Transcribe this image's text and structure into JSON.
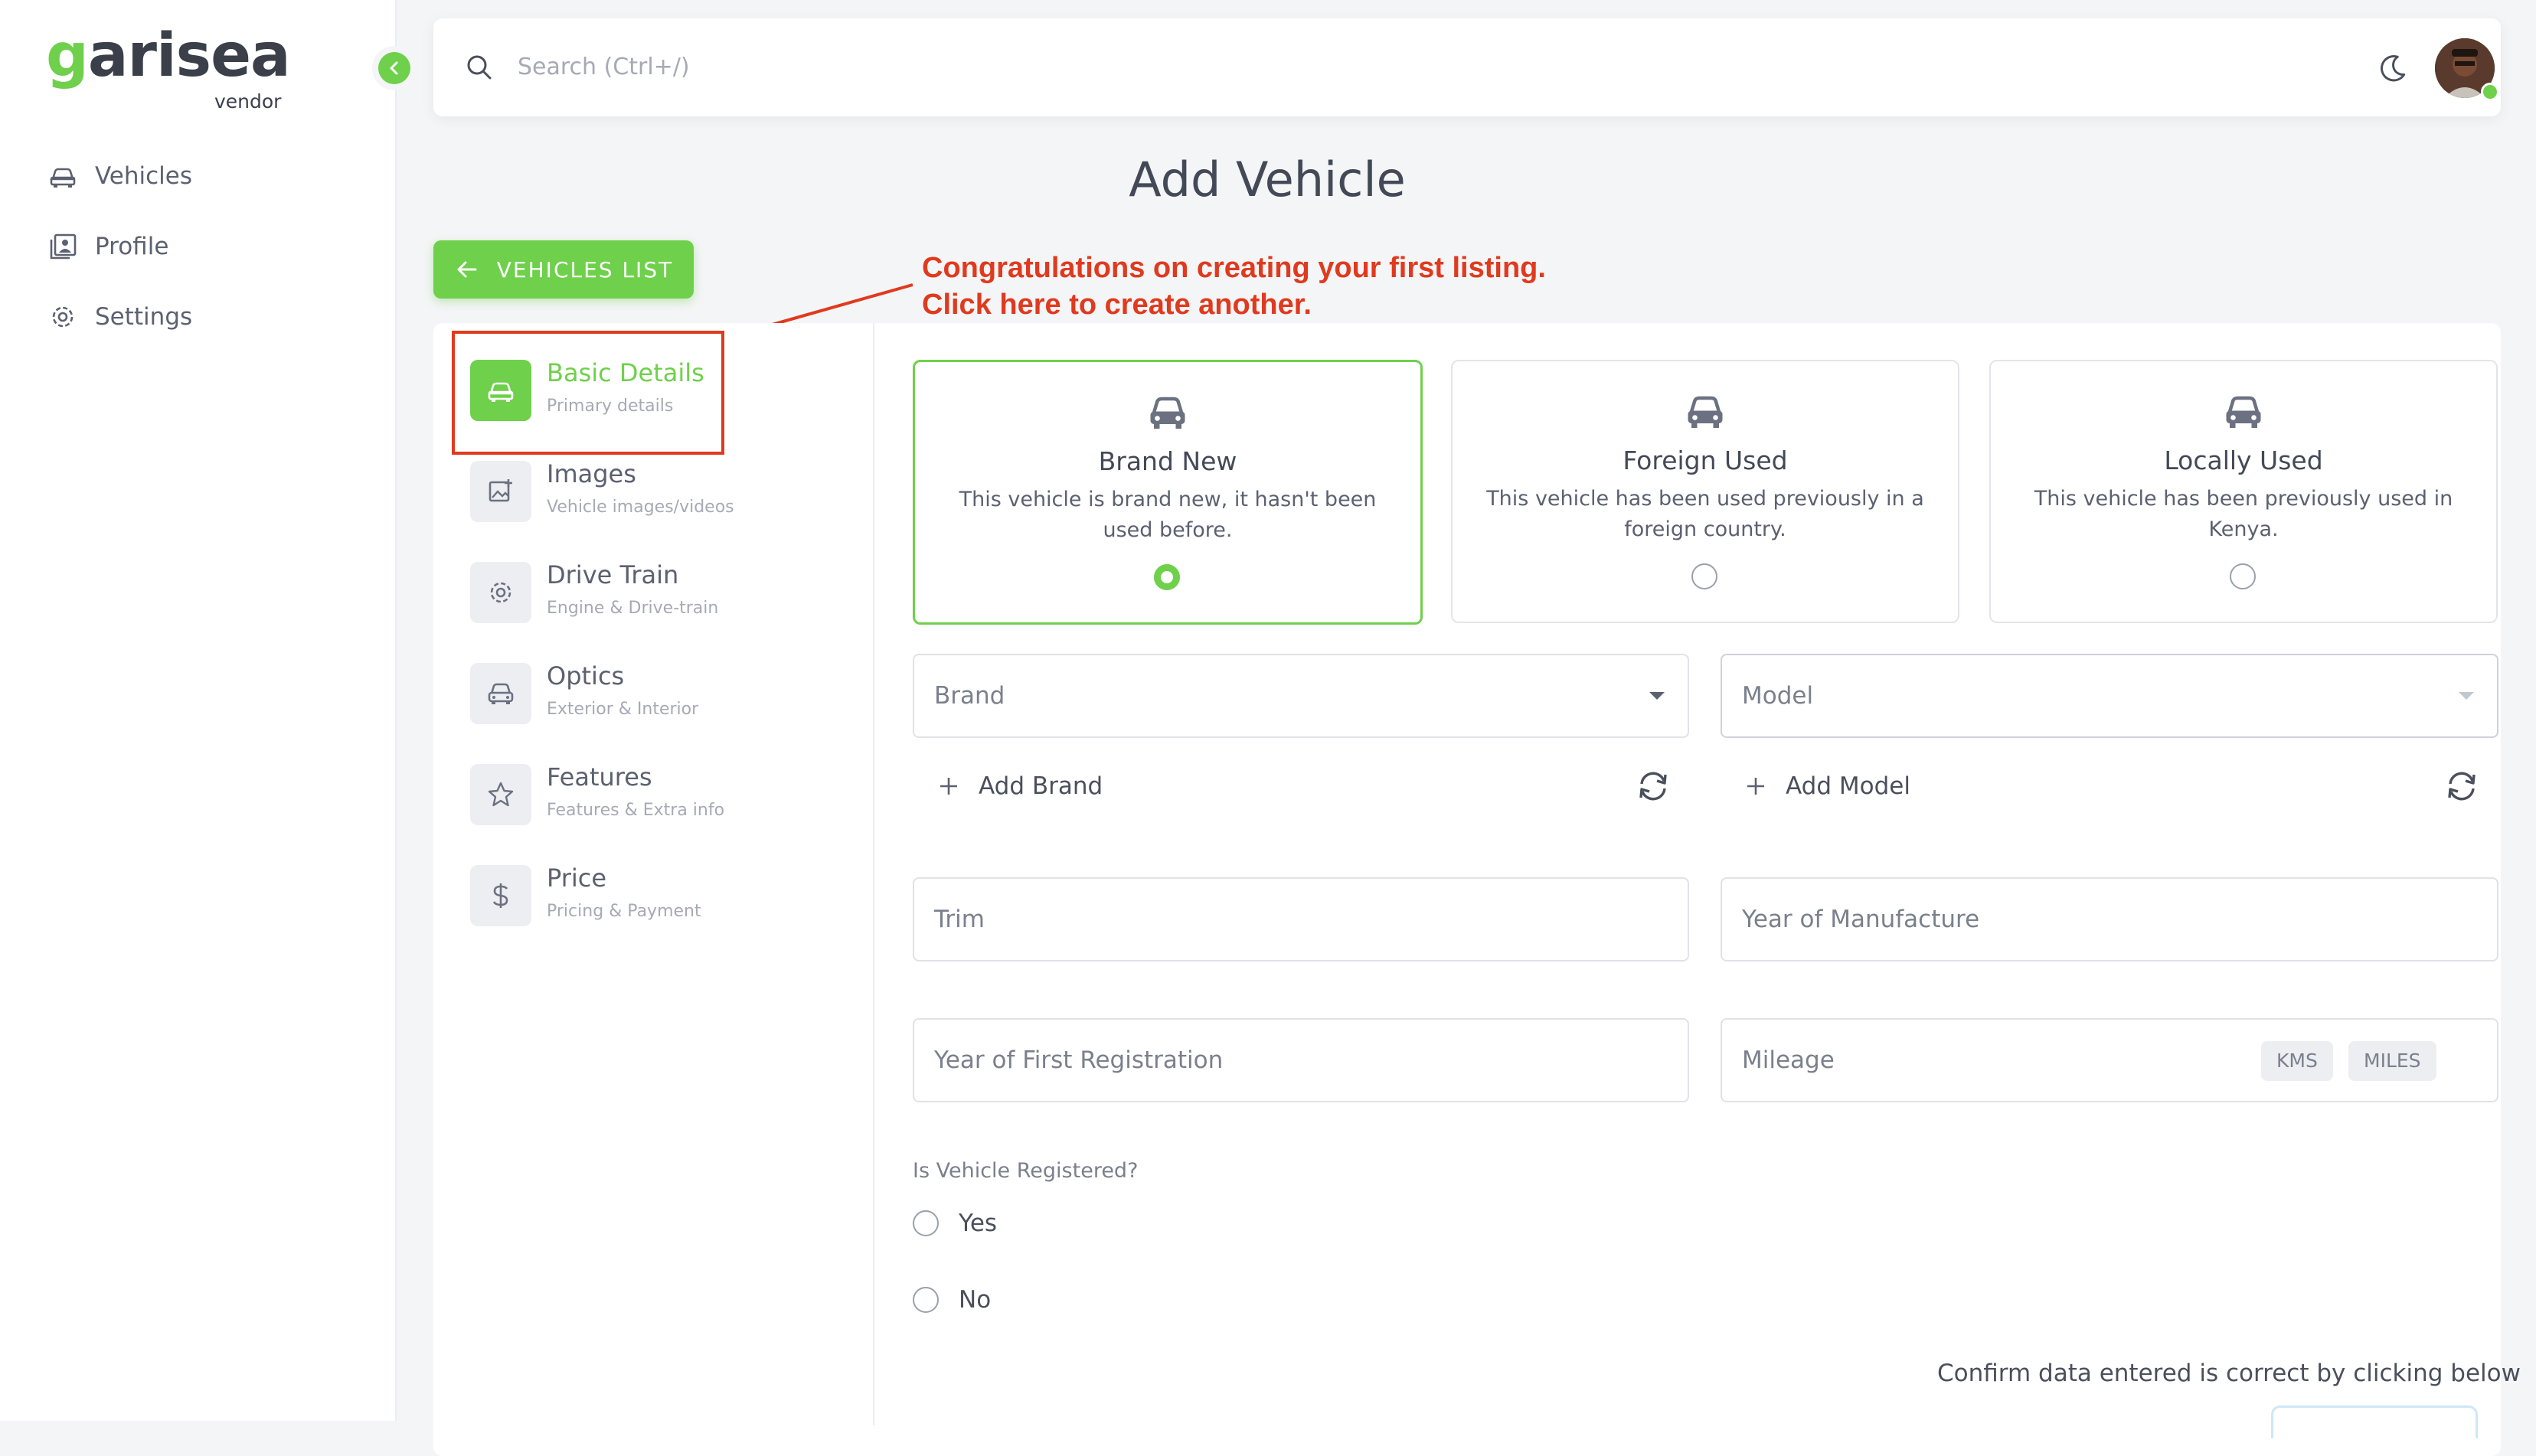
{
  "brand": {
    "logo_g": "g",
    "logo_rest": "arisea",
    "sub": "vendor"
  },
  "sidebar": {
    "items": [
      {
        "label": "Vehicles",
        "icon": "car-icon"
      },
      {
        "label": "Profile",
        "icon": "profile-icon"
      },
      {
        "label": "Settings",
        "icon": "gear-icon"
      }
    ]
  },
  "topbar": {
    "search_placeholder": "Search (Ctrl+/)"
  },
  "page": {
    "title": "Add Vehicle",
    "back_button": "VEHICLES LIST"
  },
  "annotation": {
    "line1": "Congratulations on creating your first listing.",
    "line2": "Click here to create another."
  },
  "steps": [
    {
      "title": "Basic Details",
      "subtitle": "Primary details",
      "icon": "car-icon",
      "active": true
    },
    {
      "title": "Images",
      "subtitle": "Vehicle images/videos",
      "icon": "image-add-icon"
    },
    {
      "title": "Drive Train",
      "subtitle": "Engine & Drive-train",
      "icon": "gear-icon"
    },
    {
      "title": "Optics",
      "subtitle": "Exterior & Interior",
      "icon": "car-front-icon"
    },
    {
      "title": "Features",
      "subtitle": "Features & Extra info",
      "icon": "star-icon"
    },
    {
      "title": "Price",
      "subtitle": "Pricing & Payment",
      "icon": "dollar-icon"
    }
  ],
  "conditions": [
    {
      "title": "Brand New",
      "desc": "This vehicle is brand new, it hasn't been used before.",
      "selected": true
    },
    {
      "title": "Foreign Used",
      "desc": "This vehicle has been used previously in a foreign country.",
      "selected": false
    },
    {
      "title": "Locally Used",
      "desc": "This vehicle has been previously used in Kenya.",
      "selected": false
    }
  ],
  "form": {
    "brand_placeholder": "Brand",
    "model_placeholder": "Model",
    "add_brand": "Add Brand",
    "add_model": "Add Model",
    "trim_placeholder": "Trim",
    "year_manufacture_placeholder": "Year of Manufacture",
    "year_registration_placeholder": "Year of First Registration",
    "mileage_placeholder": "Mileage",
    "unit_kms": "KMS",
    "unit_miles": "MILES",
    "registered_question": "Is Vehicle Registered?",
    "yes": "Yes",
    "no": "No",
    "confirm_text": "Confirm data entered is correct by clicking below"
  },
  "colors": {
    "accent": "#6fd04b",
    "annotation": "#e03a1e"
  }
}
